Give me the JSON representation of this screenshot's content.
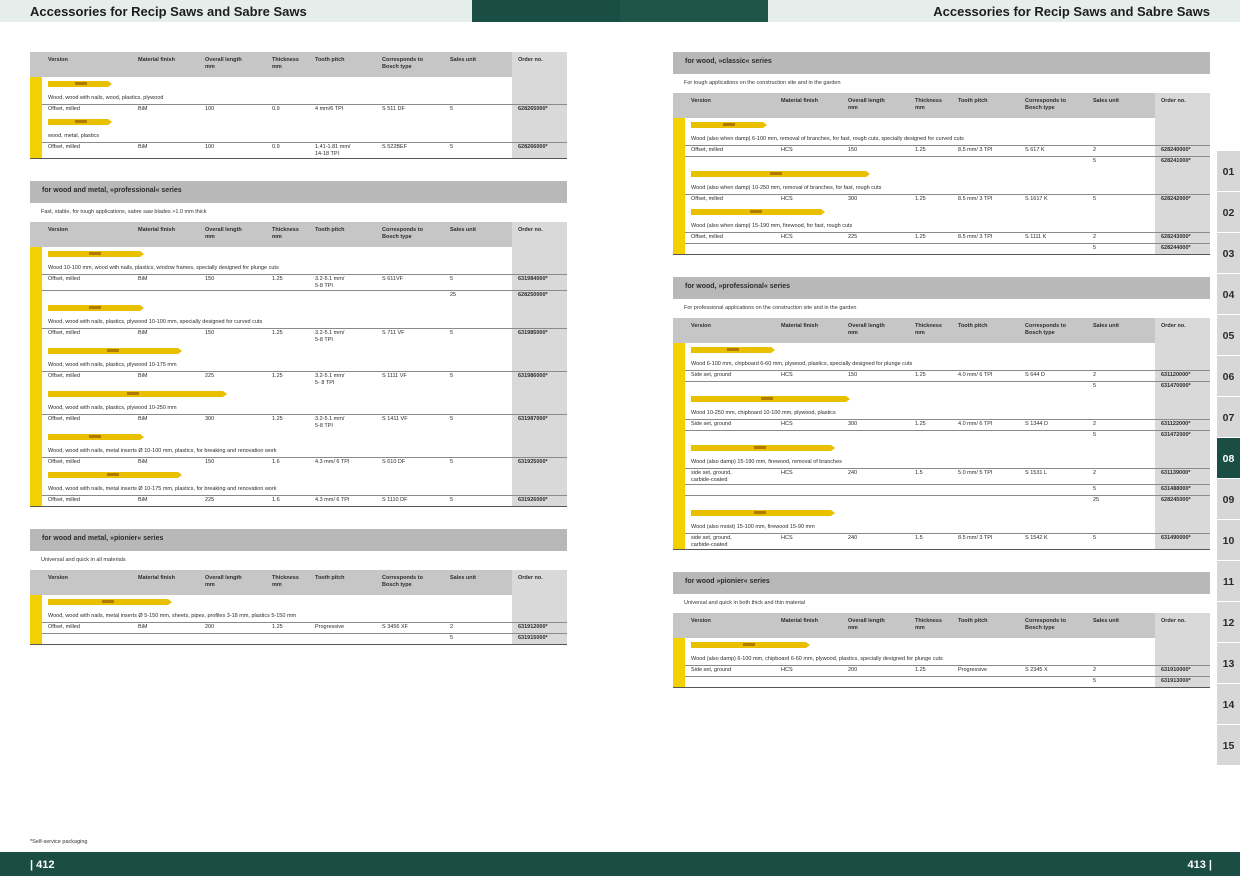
{
  "header": {
    "left_title": "Accessories for Recip Saws and Sabre Saws",
    "right_title": "Accessories for Recip Saws and Sabre Saws",
    "colors": {
      "light": "#e6eeec",
      "dark": "#1a4d43",
      "mid": "#1f5448"
    }
  },
  "columns": {
    "version": "Version",
    "material": "Material finish",
    "length": "Overall length\nmm",
    "thickness": "Thickness\nmm",
    "tooth": "Tooth pitch",
    "bosch": "Corresponds to\nBosch type",
    "unit": "Sales unit",
    "order": "Order no."
  },
  "left_sections": [
    {
      "title": "",
      "description": "",
      "products": [
        {
          "blade": 60,
          "application": "Wood, wood with nails, wood, plastics, plywood",
          "rows": [
            {
              "finish": "Offset, milled",
              "material": "BiM",
              "length": "100",
              "thickness": "0.9",
              "tooth": "4 mm/6 TPI",
              "bosch": "S 511 DF",
              "unit": "5",
              "order": "628265000*"
            }
          ]
        },
        {
          "blade": 60,
          "application": "wood, metal, plastics",
          "rows": [
            {
              "finish": "Offset, milled",
              "material": "BiM",
              "length": "100",
              "thickness": "0.9",
              "tooth": "1.41-1.81 mm/\n14-18 TPI",
              "bosch": "S 522BEF",
              "unit": "5",
              "order": "628266000*"
            }
          ]
        }
      ]
    },
    {
      "title": "for wood and metal, »professional« series",
      "description": "Fast, stable, for tough applications, sabre saw blades >1.0 mm thick",
      "products": [
        {
          "blade": 92,
          "application": "Wood 10-100 mm, wood with nails, plastics, window frames, specially designed for plunge cuts",
          "rows": [
            {
              "finish": "Offset, milled",
              "material": "BiM",
              "length": "150",
              "thickness": "1.25",
              "tooth": "3.2-5.1 mm/\n5-8 TPI",
              "bosch": "S 611VF",
              "unit": "5",
              "order": "631984000*"
            },
            {
              "finish": "",
              "material": "",
              "length": "",
              "thickness": "",
              "tooth": "",
              "bosch": "",
              "unit": "25",
              "order": "628250000*"
            }
          ]
        },
        {
          "blade": 92,
          "application": "Wood, wood with nails, plastics, plywood 10-100 mm, specially designed for curved cuts",
          "rows": [
            {
              "finish": "Offset, milled",
              "material": "BiM",
              "length": "150",
              "thickness": "1.25",
              "tooth": "3.2-5.1 mm/\n5-8 TPI",
              "bosch": "S 711 VF",
              "unit": "5",
              "order": "631985000*"
            }
          ]
        },
        {
          "blade": 130,
          "application": "Wood, wood with nails, plastics, plywood 10-175 mm",
          "rows": [
            {
              "finish": "Offset, milled",
              "material": "BiM",
              "length": "225",
              "thickness": "1.25",
              "tooth": "3.2-5.1 mm/\n5- 8 TPI",
              "bosch": "S 1111 VF",
              "unit": "5",
              "order": "631986000*"
            }
          ]
        },
        {
          "blade": 175,
          "application": "Wood, wood with nails, plastics, plywood 10-250 mm",
          "rows": [
            {
              "finish": "Offset, milled",
              "material": "BiM",
              "length": "300",
              "thickness": "1.25",
              "tooth": "3.2-5.1 mm/\n5-8 TPI",
              "bosch": "S 1411 VF",
              "unit": "5",
              "order": "631987000*"
            }
          ]
        },
        {
          "blade": 92,
          "application": "Wood, wood with nails, metal inserts Ø 10-100 mm, plastics, for breaking and renovation work",
          "rows": [
            {
              "finish": "Offset, milled",
              "material": "BiM",
              "length": "150",
              "thickness": "1.6",
              "tooth": "4.3 mm/ 6 TPI",
              "bosch": "S 610 DF",
              "unit": "5",
              "order": "631925000*"
            }
          ]
        },
        {
          "blade": 130,
          "application": "Wood, wood with nails, metal inserts Ø 10-175 mm, plastics, for breaking and renovation work",
          "rows": [
            {
              "finish": "Offset, milled",
              "material": "BiM",
              "length": "225",
              "thickness": "1.6",
              "tooth": "4.3 mm/ 6 TPI",
              "bosch": "S 1110 DF",
              "unit": "5",
              "order": "631926000*"
            }
          ]
        }
      ]
    },
    {
      "title": "for wood and metal, »pionier« series",
      "description": "Universal and quick in all materials",
      "products": [
        {
          "blade": 120,
          "application": "Wood, wood with nails, metal inserts Ø 5-150 mm, sheets, pipes, profiles 3-18 mm, plastics 5-150 mm",
          "rows": [
            {
              "finish": "Offset, milled",
              "material": "BiM",
              "length": "200",
              "thickness": "1.25",
              "tooth": "Progressive",
              "bosch": "S 3456 XF",
              "unit": "2",
              "order": "631912000*"
            },
            {
              "finish": "",
              "material": "",
              "length": "",
              "thickness": "",
              "tooth": "",
              "bosch": "",
              "unit": "5",
              "order": "631915000*"
            }
          ]
        }
      ]
    }
  ],
  "right_sections": [
    {
      "title": "for wood, »classic« series",
      "description": "For tough applications on the construction site and in the garden",
      "products": [
        {
          "blade": 72,
          "application": "Wood (also when damp) 6-100 mm, removal of branches, for fast, rough cuts, specially designed for curved cuts",
          "rows": [
            {
              "finish": "Offset, milled",
              "material": "HCS",
              "length": "150",
              "thickness": "1.25",
              "tooth": "8.5 mm/ 3 TPI",
              "bosch": "S 617 K",
              "unit": "2",
              "order": "628240000*"
            },
            {
              "finish": "",
              "material": "",
              "length": "",
              "thickness": "",
              "tooth": "",
              "bosch": "",
              "unit": "5",
              "order": "628241000*"
            }
          ]
        },
        {
          "blade": 175,
          "application": "Wood (also when damp) 10-250 mm, removal of branches, for fast, rough cuts",
          "rows": [
            {
              "finish": "Offset, milled",
              "material": "HCS",
              "length": "300",
              "thickness": "1.25",
              "tooth": "8.5 mm/ 3 TPI",
              "bosch": "S 1617 K",
              "unit": "5",
              "order": "628242000*"
            }
          ]
        },
        {
          "blade": 130,
          "application": "Wood (also when damp) 15-190 mm, firewood, for fast, rough cuts",
          "rows": [
            {
              "finish": "Offset, milled",
              "material": "HCS",
              "length": "225",
              "thickness": "1.25",
              "tooth": "8.5 mm/ 3 TPI",
              "bosch": "S 1111 K",
              "unit": "2",
              "order": "628243000*"
            },
            {
              "finish": "",
              "material": "",
              "length": "",
              "thickness": "",
              "tooth": "",
              "bosch": "",
              "unit": "5",
              "order": "628244000*"
            }
          ]
        }
      ]
    },
    {
      "title": "for wood, »professional« series",
      "description": "For professional applications on the construction site and in the garden",
      "products": [
        {
          "blade": 80,
          "application": "Wood 6-100 mm, chipboard 6-60 mm, plywood, plastics, specially designed for plunge cuts",
          "rows": [
            {
              "finish": "Side set, ground",
              "material": "HCS",
              "length": "150",
              "thickness": "1.25",
              "tooth": "4.0 mm/ 6 TPI",
              "bosch": "S 644 D",
              "unit": "2",
              "order": "631120000*"
            },
            {
              "finish": "",
              "material": "",
              "length": "",
              "thickness": "",
              "tooth": "",
              "bosch": "",
              "unit": "5",
              "order": "631470000*"
            }
          ]
        },
        {
          "blade": 155,
          "application": "Wood 10-250 mm, chipboard 10-100 mm, plywood, plastics",
          "rows": [
            {
              "finish": "Side set, ground",
              "material": "HCS",
              "length": "300",
              "thickness": "1.25",
              "tooth": "4.0 mm/ 6 TPI",
              "bosch": "S 1344 D",
              "unit": "2",
              "order": "631122000*"
            },
            {
              "finish": "",
              "material": "",
              "length": "",
              "thickness": "",
              "tooth": "",
              "bosch": "",
              "unit": "5",
              "order": "631472000*"
            }
          ]
        },
        {
          "blade": 140,
          "application": "Wood (also damp) 15-190 mm, firewood, removal of branches",
          "rows": [
            {
              "finish": "side set, ground,\ncarbide-coated",
              "material": "HCS",
              "length": "240",
              "thickness": "1.5",
              "tooth": "5.0 mm/ 5 TPI",
              "bosch": "S 1531 L",
              "unit": "2",
              "order": "631139000*"
            },
            {
              "finish": "",
              "material": "",
              "length": "",
              "thickness": "",
              "tooth": "",
              "bosch": "",
              "unit": "5",
              "order": "631488000*"
            },
            {
              "finish": "",
              "material": "",
              "length": "",
              "thickness": "",
              "tooth": "",
              "bosch": "",
              "unit": "25",
              "order": "628245000*"
            }
          ]
        },
        {
          "blade": 140,
          "application": "Wood (also moist) 15-100 mm, firewood 15-90 mm",
          "rows": [
            {
              "finish": "side set, ground,\ncarbide-coated",
              "material": "HCS",
              "length": "240",
              "thickness": "1.5",
              "tooth": "8.5 mm/ 3 TPI",
              "bosch": "S 1542 K",
              "unit": "5",
              "order": "631490000*"
            }
          ]
        }
      ]
    },
    {
      "title": "for wood »pionier« series",
      "description": "Universal and quick in both thick and thin material",
      "products": [
        {
          "blade": 115,
          "application": "Wood (also damp) 6-100 mm, chipboard 6-60 mm, plywood, plastics, specially designed for plunge cuts",
          "rows": [
            {
              "finish": "Side set, ground",
              "material": "HCS",
              "length": "200",
              "thickness": "1.25",
              "tooth": "Progressive",
              "bosch": "S 2345 X",
              "unit": "2",
              "order": "631910000*"
            },
            {
              "finish": "",
              "material": "",
              "length": "",
              "thickness": "",
              "tooth": "",
              "bosch": "",
              "unit": "5",
              "order": "631913000*"
            }
          ]
        }
      ]
    }
  ],
  "chapter_tabs": [
    "01",
    "02",
    "03",
    "04",
    "05",
    "06",
    "07",
    "08",
    "09",
    "10",
    "11",
    "12",
    "13",
    "14",
    "15"
  ],
  "active_tab": "08",
  "footnote": "*Self-service packaging",
  "page_left": "| 412",
  "page_right": "413 |"
}
